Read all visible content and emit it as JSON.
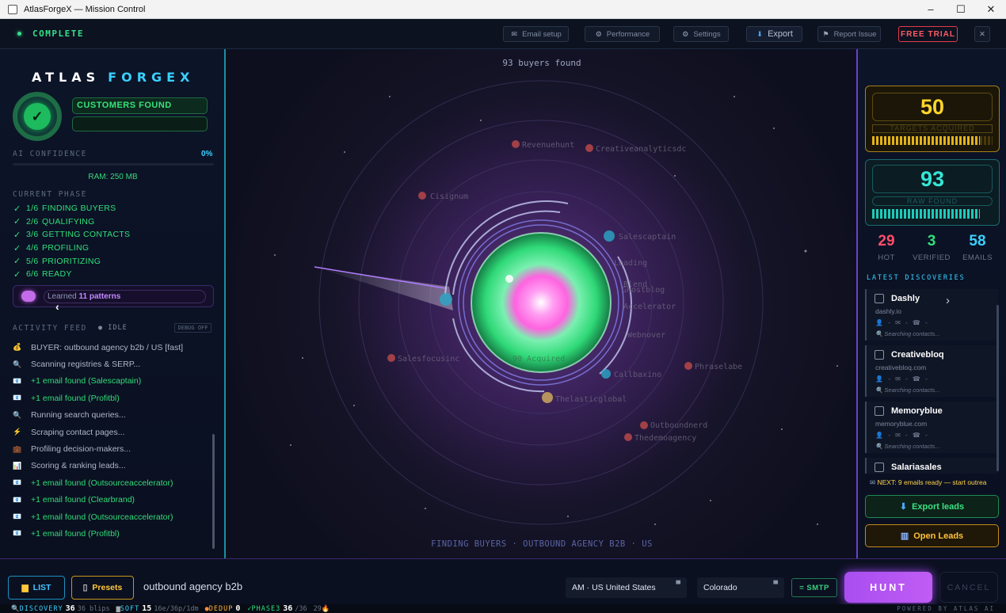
{
  "window": {
    "title": "AtlasForgeX — Mission Control",
    "min": "–",
    "max": "☐",
    "close": "✕"
  },
  "topbar": {
    "status": "COMPLETE",
    "email_setup": "Email setup",
    "performance": "Performance",
    "settings": "Settings",
    "export": "Export",
    "report_issue": "Report Issue",
    "free_trial": "FREE TRIAL",
    "close": "✕"
  },
  "left": {
    "brand_a": "ATLAS",
    "brand_b": "FORGEX",
    "customers_found": "CUSTOMERS FOUND",
    "ai_confidence_label": "AI CONFIDENCE",
    "ai_confidence_value": "0%",
    "ram": "RAM: 250 MB",
    "current_phase_label": "CURRENT PHASE",
    "phases": [
      {
        "num": "1/6",
        "label": "FINDING BUYERS"
      },
      {
        "num": "2/6",
        "label": "QUALIFYING"
      },
      {
        "num": "3/6",
        "label": "GETTING CONTACTS"
      },
      {
        "num": "4/6",
        "label": "PROFILING"
      },
      {
        "num": "5/6",
        "label": "PRIORITIZING"
      },
      {
        "num": "6/6",
        "label": "READY"
      }
    ],
    "learned_prefix": "Learned",
    "learned_count": "11 patterns",
    "activity_label": "ACTIVITY FEED",
    "idle": "● IDLE",
    "debug": "DEBUG OFF",
    "feed": [
      {
        "icon": "💰",
        "text": "BUYER: outbound agency b2b / US [fast]",
        "green": false
      },
      {
        "icon": "🔍",
        "text": "Scanning registries & SERP...",
        "green": false
      },
      {
        "icon": "📧",
        "text": "+1 email found (Salescaptain)",
        "green": true
      },
      {
        "icon": "📧",
        "text": "+1 email found (Profitbl)",
        "green": true
      },
      {
        "icon": "🔍",
        "text": "Running search queries...",
        "green": false
      },
      {
        "icon": "⚡",
        "text": "Scraping contact pages...",
        "green": false
      },
      {
        "icon": "💼",
        "text": "Profiling decision-makers...",
        "green": false
      },
      {
        "icon": "📊",
        "text": "Scoring & ranking leads...",
        "green": false
      },
      {
        "icon": "📧",
        "text": "+1 email found (Outsourceaccelerator)",
        "green": true
      },
      {
        "icon": "📧",
        "text": "+1 email found (Clearbrand)",
        "green": true
      },
      {
        "icon": "📧",
        "text": "+1 email found (Outsourceaccelerator)",
        "green": true
      },
      {
        "icon": "📧",
        "text": "+1 email found (Profitbl)",
        "green": true
      }
    ]
  },
  "center": {
    "buyers_found": "93 buyers found",
    "caption": "FINDING BUYERS · OUTBOUND AGENCY B2B · US"
  },
  "right": {
    "targets_value": "50",
    "targets_label": "TARGETS ACQUIRED",
    "raw_value": "93",
    "raw_label": "RAW FOUND",
    "hot_value": "29",
    "hot_label": "HOT",
    "verified_value": "3",
    "verified_label": "VERIFIED",
    "emails_value": "58",
    "emails_label": "EMAILS",
    "latest_label": "LATEST DISCOVERIES",
    "cards": [
      {
        "name": "Dashly",
        "domain": "dashly.io",
        "meta": "👤 - ✉ - ☎ -",
        "searching": "🔍 Searching contacts..."
      },
      {
        "name": "Creativebloq",
        "domain": "creativebloq.com",
        "meta": "👤 - ✉ - ☎ -",
        "searching": "🔍 Searching contacts..."
      },
      {
        "name": "Memoryblue",
        "domain": "memoryblue.com",
        "meta": "👤 - ✉ - ☎ -",
        "searching": "🔍 Searching contacts..."
      },
      {
        "name": "Salariasales",
        "domain": "",
        "meta": "",
        "searching": ""
      }
    ],
    "next": "NEXT: 9 emails ready — start outrea",
    "export_leads": "Export leads",
    "open_leads": "Open Leads"
  },
  "bottom": {
    "list": "LIST",
    "presets": "Presets",
    "query": "outbound agency b2b",
    "country": "AM · US  United States",
    "region": "Colorado",
    "smtp": "= SMTP",
    "hunt": "HUNT",
    "cancel": "CANCEL"
  },
  "statusbar": {
    "discovery_label": "DISCOVERY",
    "discovery_value": "36",
    "discovery_sub": "36 blips",
    "soft_label": "SOFT",
    "soft_value": "15",
    "soft_sub": "16e/36p/1dm",
    "dedup_label": "DEDUP",
    "dedup_value": "0",
    "phase3_label": "PHASE3",
    "phase3_value": "36",
    "phase3_sub": "/36",
    "tail": "29🔥",
    "powered": "POWERED BY ATLAS AI"
  },
  "colors": {
    "accent_cyan": "#3ad0ff",
    "green": "#2fe07a",
    "gold": "#ffd52a",
    "purple": "#b35af0",
    "hot": "#ff4d6a"
  }
}
